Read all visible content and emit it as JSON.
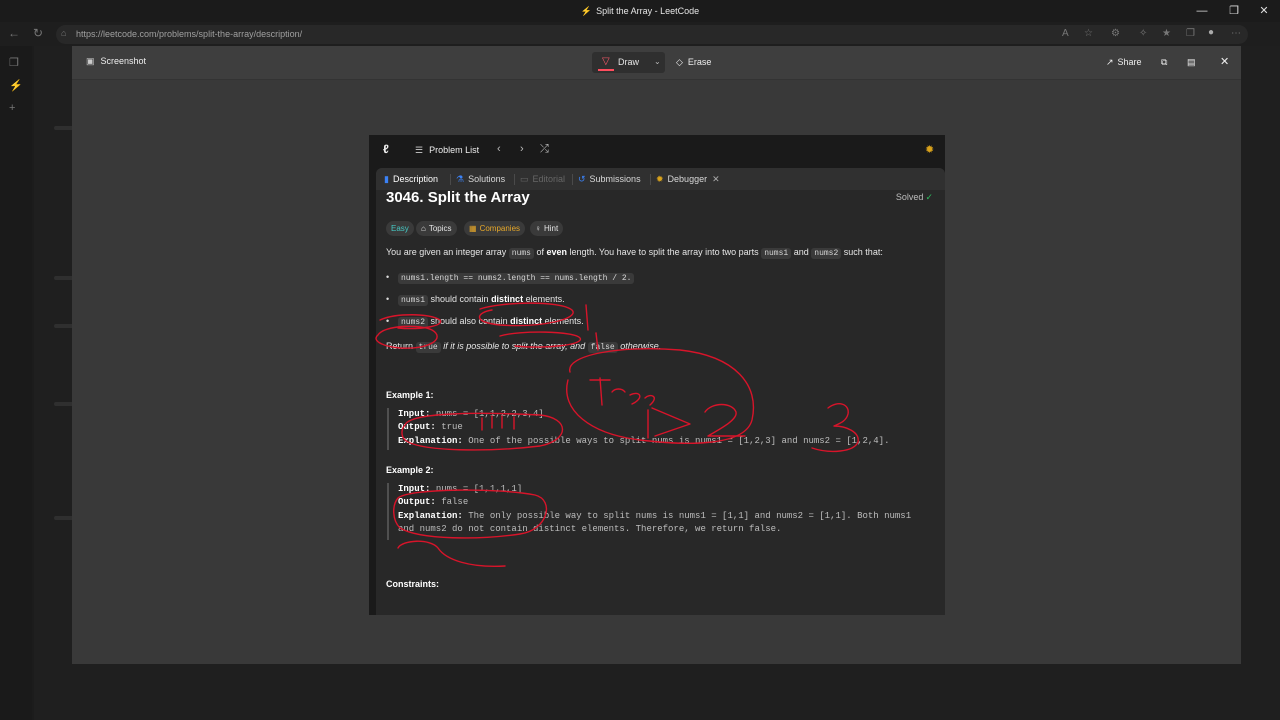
{
  "window": {
    "title": "Split the Array - LeetCode",
    "controls": [
      "—",
      "❐",
      "✕"
    ]
  },
  "browser": {
    "url": "https://leetcode.com/problems/split-the-array/description/"
  },
  "screenshot_tool": {
    "label": "Screenshot",
    "draw_label": "Draw",
    "erase_label": "Erase",
    "share_label": "Share"
  },
  "leetcode": {
    "problem_list": "Problem List",
    "tabs": [
      {
        "label": "Description",
        "icon": "description-icon",
        "color": "#3b82f6"
      },
      {
        "label": "Solutions",
        "icon": "flask-icon",
        "color": "#3b82f6"
      },
      {
        "label": "Editorial",
        "icon": "book-icon",
        "color": "#555"
      },
      {
        "label": "Submissions",
        "icon": "history-icon",
        "color": "#3b82f6"
      },
      {
        "label": "Debugger",
        "icon": "bug-icon",
        "color": "#d9a21b"
      }
    ],
    "problem": {
      "title": "3046. Split the Array",
      "status": "Solved",
      "tags": [
        "Easy",
        "Topics",
        "Companies",
        "Hint"
      ],
      "intro": {
        "p1": "You are given an integer array",
        "c1": "nums",
        "p2": "of",
        "b1": "even",
        "p3": "length. You have to split the array into two parts",
        "c2": "nums1",
        "p4": "and",
        "c3": "nums2",
        "p5": "such that:"
      },
      "bullets": [
        {
          "code": "nums1.length == nums2.length == nums.length / 2.",
          "pre": "",
          "bold": "",
          "post": ""
        },
        {
          "code": "nums1",
          "pre": " should contain ",
          "bold": "distinct",
          "post": " elements."
        },
        {
          "code": "nums2",
          "pre": " should also contain ",
          "bold": "distinct",
          "post": " elements."
        }
      ],
      "return_line": {
        "p1": "Return",
        "c1": "true",
        "i1": "if it is possible to split the array, and",
        "c2": "false",
        "i2": "otherwise."
      },
      "examples": [
        {
          "heading": "Example 1:",
          "input_label": "Input:",
          "input": "nums = [1,1,2,2,3,4]",
          "output_label": "Output:",
          "output": "true",
          "explanation_label": "Explanation:",
          "explanation": [
            "One of the possible ways to split nums is nums1 = [1,2,3] and nums2 = [1,2,4]."
          ]
        },
        {
          "heading": "Example 2:",
          "input_label": "Input:",
          "input": "nums = [1,1,1,1]",
          "output_label": "Output:",
          "output": "false",
          "explanation_label": "Explanation:",
          "explanation": [
            "The only possible way to split nums is nums1 = [1,1] and nums2 = [1,1]. Both nums1",
            "and nums2 do not contain distinct elements. Therefore, we return false."
          ]
        }
      ],
      "constraints_heading": "Constraints:"
    }
  },
  "annotation": {
    "color": "#d8142a",
    "marks": [
      "1",
      "[1,1]",
      "true",
      "2",
      "3"
    ]
  }
}
